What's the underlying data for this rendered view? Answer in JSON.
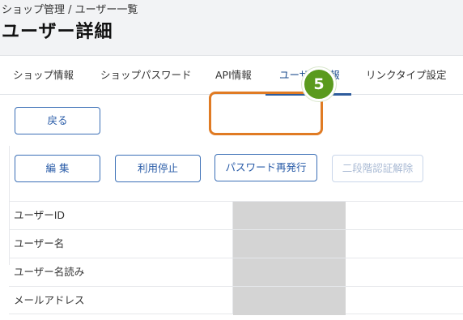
{
  "breadcrumb": "ショップ管理 / ユーザー一覧",
  "title": "ユーザー詳細",
  "tabs": [
    {
      "label": "ショップ情報",
      "active": false
    },
    {
      "label": "ショップパスワード",
      "active": false
    },
    {
      "label": "API情報",
      "active": false
    },
    {
      "label": "ユーザー情報",
      "active": true
    },
    {
      "label": "リンクタイプ設定",
      "active": false
    }
  ],
  "buttons": {
    "back": "戻る",
    "edit": "編 集",
    "suspend": "利用停止",
    "reissue_password": "パスワード再発行",
    "disable_2fa": "二段階認証解除"
  },
  "step_badge": "5",
  "table": {
    "rows": [
      {
        "label": "ユーザーID"
      },
      {
        "label": "ユーザー名"
      },
      {
        "label": "ユーザー名読み"
      },
      {
        "label": "メールアドレス"
      }
    ]
  },
  "colors": {
    "accent": "#2e5c9c",
    "highlight": "#e07b24",
    "badge": "#5a9a1e",
    "masked": "#d4d4d4"
  }
}
